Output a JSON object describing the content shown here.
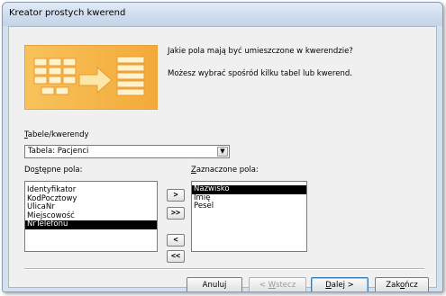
{
  "window": {
    "title": "Kreator prostych kwerend"
  },
  "description": {
    "line1": "Jakie pola mają być umieszczone w kwerendzie?",
    "line2": "Możesz wybrać spośród kilku tabel lub kwerend."
  },
  "table_select": {
    "label_underlined": "T",
    "label_rest": "abele/kwerendy",
    "value": "Tabela: Pacjenci"
  },
  "available": {
    "label_before": "Do",
    "label_underlined": "s",
    "label_after": "tępne pola:",
    "items": [
      "Identyfikator",
      "KodPocztowy",
      "UlicaNr",
      "Miejscowość",
      "NrTelefonu"
    ],
    "selected_index": 4
  },
  "selected": {
    "label_underlined": "Z",
    "label_rest": "aznaczone pola:",
    "items": [
      "Nazwisko",
      "Imię",
      "Pesel"
    ],
    "selected_index": 0
  },
  "move_buttons": {
    "add_one": ">",
    "add_all": ">>",
    "remove_one": "<",
    "remove_all": "<<"
  },
  "buttons": {
    "cancel": "Anuluj",
    "back_prefix": "< ",
    "back_underlined": "W",
    "back_rest": "stecz",
    "next_underlined": "D",
    "next_rest": "alej >",
    "finish_before": "Zak",
    "finish_underlined": "o",
    "finish_after": "ńcz"
  },
  "colors": {
    "selection": "#000000",
    "graphic_accent": "#f4a93a"
  }
}
